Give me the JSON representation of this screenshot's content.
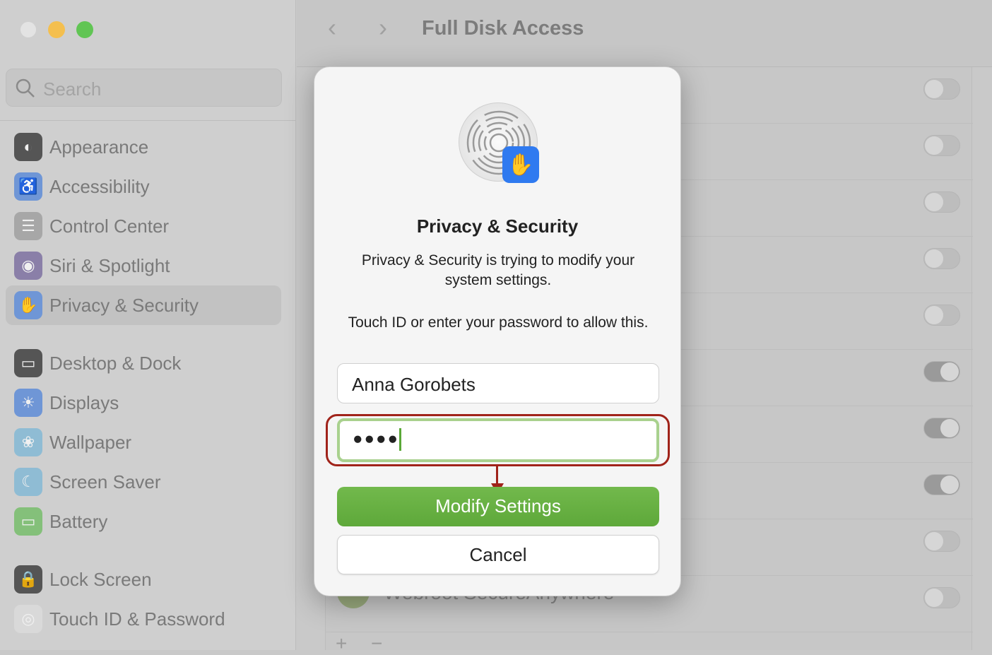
{
  "window": {
    "traffic_colors": {
      "close": "#e3e3e3",
      "minimize": "#f4bf4f",
      "zoom": "#61c554"
    }
  },
  "sidebar": {
    "search_placeholder": "Search",
    "items": [
      {
        "label": "Appearance",
        "icon": "appearance-icon",
        "color": "#555555",
        "glyph": "◐"
      },
      {
        "label": "Accessibility",
        "icon": "accessibility-icon",
        "color": "#6f96d6",
        "glyph": "♿"
      },
      {
        "label": "Control Center",
        "icon": "control-center-icon",
        "color": "#a7a7a7",
        "glyph": "☰"
      },
      {
        "label": "Siri & Spotlight",
        "icon": "siri-icon",
        "color": "#8a7fa8",
        "glyph": "◉"
      },
      {
        "label": "Privacy & Security",
        "icon": "hand-icon",
        "color": "#6f96d6",
        "glyph": "✋",
        "selected": true
      },
      {
        "label": "Desktop & Dock",
        "icon": "desktop-dock-icon",
        "color": "#555555",
        "glyph": "▭"
      },
      {
        "label": "Displays",
        "icon": "displays-icon",
        "color": "#6f96d6",
        "glyph": "☀"
      },
      {
        "label": "Wallpaper",
        "icon": "wallpaper-icon",
        "color": "#8fbcd4",
        "glyph": "❀"
      },
      {
        "label": "Screen Saver",
        "icon": "screen-saver-icon",
        "color": "#8fbcd4",
        "glyph": "☾"
      },
      {
        "label": "Battery",
        "icon": "battery-icon",
        "color": "#84c07a",
        "glyph": "▭"
      },
      {
        "label": "Lock Screen",
        "icon": "lock-icon",
        "color": "#555555",
        "glyph": "🔒"
      },
      {
        "label": "Touch ID & Password",
        "icon": "fingerprint-icon",
        "color": "#d9d9d9",
        "glyph": "◎"
      }
    ]
  },
  "header": {
    "title": "Full Disk Access",
    "back": "‹",
    "forward": "›"
  },
  "list": {
    "toggles": [
      false,
      false,
      false,
      false,
      false,
      true,
      true,
      true,
      false,
      false
    ],
    "last_app": "Webroot SecureAnywhere",
    "add": "+",
    "remove": "−"
  },
  "dialog": {
    "title": "Privacy & Security",
    "message": "Privacy & Security is trying to modify your system settings.",
    "prompt": "Touch ID or enter your password to allow this.",
    "username": "Anna Gorobets",
    "password_mask": "●●●●",
    "primary_label": "Modify Settings",
    "cancel_label": "Cancel",
    "hand_glyph": "✋"
  }
}
